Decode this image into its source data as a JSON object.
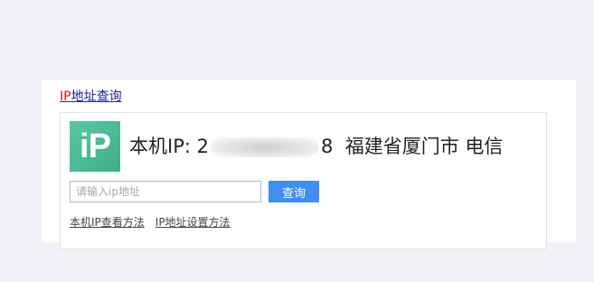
{
  "widget": {
    "title_ip": "IP",
    "title_rest": "地址查询",
    "logo_text": "iP",
    "result": {
      "label": "本机IP:",
      "ip_prefix": "2",
      "ip_suffix": "8",
      "location": "福建省厦门市 电信"
    },
    "search": {
      "placeholder": "请输入ip地址",
      "value": "",
      "button_label": "查询"
    },
    "links": [
      "本机IP查看方法",
      "IP地址设置方法"
    ]
  },
  "colors": {
    "page_background": "#f1f3f9",
    "logo_green": "#45b58e",
    "button_blue": "#3e8ff0",
    "title_red": "#d4160f",
    "title_blue": "#1b1b9c"
  }
}
